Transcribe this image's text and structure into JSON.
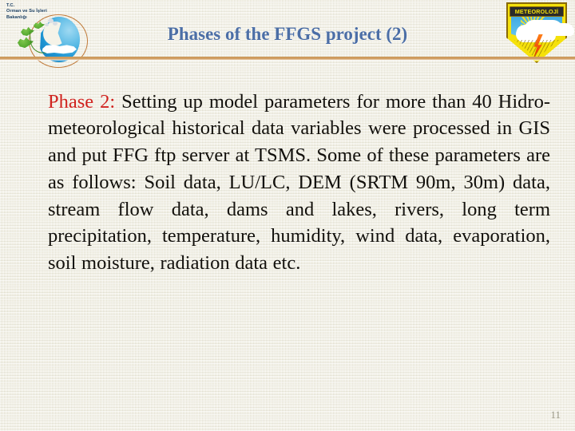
{
  "slide": {
    "title": "Phases of the FFGS project  (2)",
    "title_color": "#4b6ea6",
    "background_color": "#f3f1e4",
    "divider_color": "#c68d4c",
    "page_number": "11"
  },
  "left_logo": {
    "name": "ministry-of-forestry-and-water-affairs-logo",
    "line1": "T.C.",
    "line2": "Orman ve Su İşleri",
    "line3": "Bakanlığı"
  },
  "right_logo": {
    "name": "turkish-state-meteorological-service-logo",
    "banner_text": "METEOROLOJİ"
  },
  "body": {
    "phase_label": "Phase 2:",
    "phase_label_color": "#d0231f",
    "text": " Setting  up model parameters for more  than 40 Hidro-meteorological  historical  data  variables  were processed  in GIS   and put FFG ftp server at TSMS. Some  of  these  parameters  are  as  follows: Soil  data, LU/LC,  DEM  (SRTM  90m,  30m)   data,  stream  flow data,  dams and lakes, rivers, long  term precipitation, temperature,  humidity,  wind  data,  evaporation,  soil moisture, radiation data etc."
  }
}
